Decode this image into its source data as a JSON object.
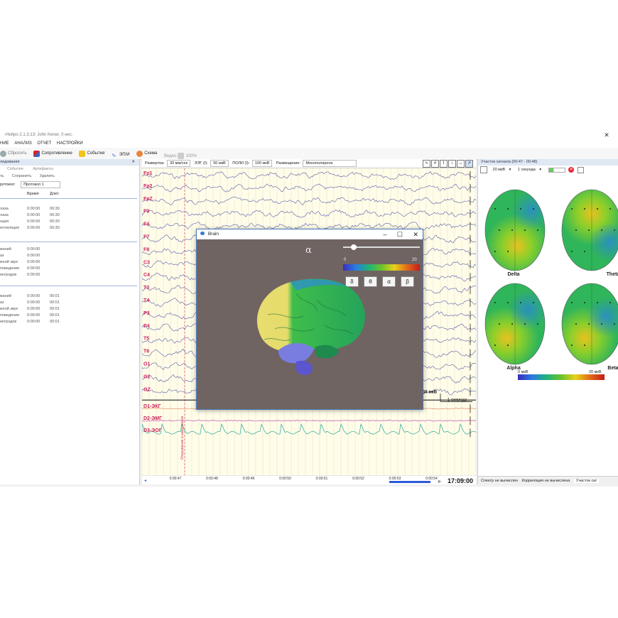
{
  "window": {
    "title": "-Нейро 2.1.3.13: John Kener, 0 нес."
  },
  "menu": [
    "НИЕ",
    "АНАЛИЗ",
    "ОТЧЕТ",
    "НАСТРОЙКИ"
  ],
  "toolbar": {
    "reset": "Сбросить",
    "impedance": "Сопротивление",
    "events": "События",
    "evoked": "ЭП/И",
    "scheme": "Схема",
    "video": "Видео",
    "zoom": "100%"
  },
  "left_panel": {
    "header": "ледования",
    "buttons1": [
      "События",
      "Артефакты"
    ],
    "buttons2": [
      "ть",
      "Сохранить",
      "Удалить"
    ],
    "protocol_label": "ротокол:",
    "protocol_value": "Протокол 1",
    "col_time": "Время",
    "col_duration": "Длит.",
    "group1": [
      {
        "name": "лаза",
        "time": "0:00:00",
        "dur": "00:30"
      },
      {
        "name": "лаза",
        "time": "0:00:00",
        "dur": "00:30"
      },
      {
        "name": "нция",
        "time": "0:00:00",
        "dur": "00:30"
      },
      {
        "name": "ентиляция",
        "time": "0:00:00",
        "dur": "00:30"
      }
    ],
    "group2": [
      {
        "name": "жаний",
        "time": "0:00:00"
      },
      {
        "name": "аз",
        "time": "0:00:00"
      },
      {
        "name": "жной звук",
        "time": "0:00:00"
      },
      {
        "name": "поведение",
        "time": "0:00:00"
      },
      {
        "name": "ектродов",
        "time": "0:00:00"
      }
    ],
    "group3": [
      {
        "name": "жаний",
        "time": "0:00:00",
        "dur": "00:01"
      },
      {
        "name": "аз",
        "time": "0:00:00",
        "dur": "00:01"
      },
      {
        "name": "жной звук",
        "time": "0:00:00",
        "dur": "00:01"
      },
      {
        "name": "поведение",
        "time": "0:00:00",
        "dur": "00:01"
      },
      {
        "name": "ектродов",
        "time": "0:00:00",
        "dur": "00:01"
      }
    ]
  },
  "eeg_toolbar": {
    "sweep_label": "Развертка:",
    "sweep_value": "30 мм/сек",
    "eeg_label": "ЭЭГ (I):",
    "eeg_value": "50 мкВ",
    "poly_label": "ПОЛИ (I):",
    "poly_value": "100 мкВ",
    "montage_label": "Размещение:",
    "montage_value": "Монополярное"
  },
  "channels": [
    "Fp1",
    "Fp2",
    "FpZ",
    "F3",
    "F4",
    "F7",
    "F8",
    "C3",
    "C4",
    "T3",
    "T4",
    "P3",
    "P4",
    "T5",
    "T6",
    "O1",
    "O2",
    "OZ"
  ],
  "poly_channels": [
    "D1-ЭКГ",
    "D2-ЭМГ",
    "D3-ЭОГ"
  ],
  "channel_color": "#cc1f5a",
  "event_marker_text": "Открывание и закрывание",
  "scale_bar": {
    "amplitude": "50 мкВ",
    "time": "1 секунда"
  },
  "time_ticks": [
    "0:00:47",
    "0:00:48",
    "0:00:49",
    "0:00:50",
    "0:00:51",
    "0:00:52",
    "0:00:53",
    "0:00:54"
  ],
  "clock": "17:09:00",
  "brain_window": {
    "title": "Brain",
    "wave_symbol": "α",
    "scale_min": "0",
    "scale_max": "20",
    "buttons": [
      "δ",
      "θ",
      "α",
      "β"
    ]
  },
  "right_panel": {
    "header": "Участок сигнала (00:47 - 00:48)",
    "amp_value": "20 мкВ",
    "dur_value": "1 секунда",
    "maps": [
      "Delta",
      "Theta",
      "Alpha",
      "Beta"
    ],
    "scale_min": "0 мкВ",
    "scale_max": "20 мкВ",
    "tabs": [
      "Спектр не вычислен",
      "Корреляция не вычислена",
      "Участок сиг"
    ]
  }
}
